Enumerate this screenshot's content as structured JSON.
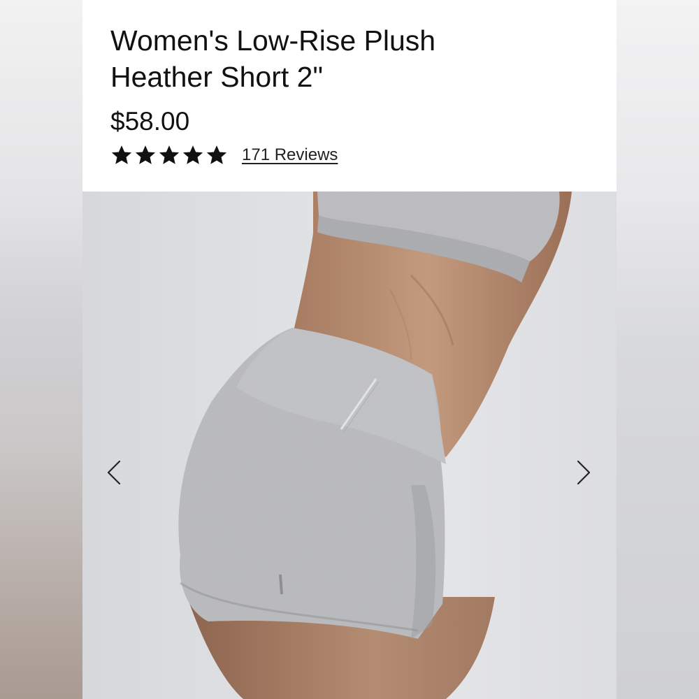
{
  "product": {
    "title_line1": "Women's Low-Rise Plush",
    "title_line2": "Heather Short 2\"",
    "price": "$58.00",
    "rating": {
      "stars": 5,
      "max_stars": 5,
      "reviews_label": "171 Reviews"
    }
  },
  "gallery": {
    "prev_icon": "chevron-left-icon",
    "next_icon": "chevron-right-icon"
  },
  "colors": {
    "text": "#111111",
    "star": "#111111",
    "background": "#ffffff",
    "fabric": "#b9babd",
    "skin": "#b98f74"
  }
}
